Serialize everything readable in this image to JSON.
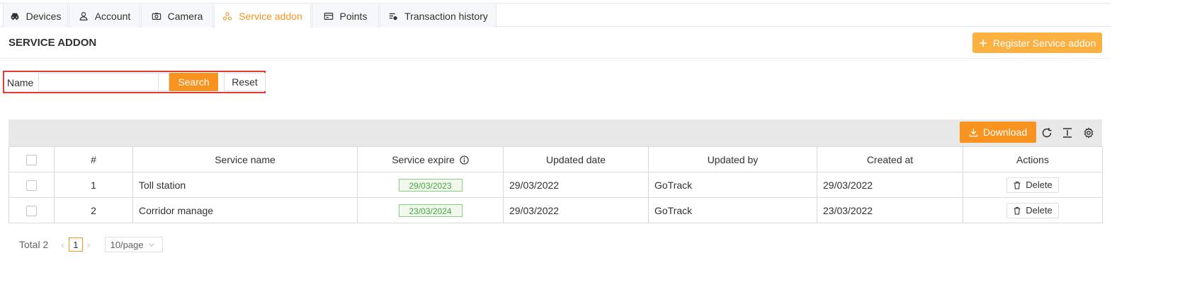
{
  "tabs": [
    {
      "label": "Devices",
      "icon": "car-icon"
    },
    {
      "label": "Account",
      "icon": "user-icon"
    },
    {
      "label": "Camera",
      "icon": "camera-icon"
    },
    {
      "label": "Service addon",
      "icon": "addon-icon",
      "active": true
    },
    {
      "label": "Points",
      "icon": "card-icon"
    },
    {
      "label": "Transaction history",
      "icon": "history-icon"
    }
  ],
  "header": {
    "title": "SERVICE ADDON",
    "register_label": "Register Service addon"
  },
  "search": {
    "name_label": "Name",
    "name_value": "",
    "search_label": "Search",
    "reset_label": "Reset"
  },
  "toolbar": {
    "download_label": "Download"
  },
  "table": {
    "columns": {
      "index": "#",
      "service_name": "Service name",
      "service_expire": "Service expire",
      "updated_date": "Updated date",
      "updated_by": "Updated by",
      "created_at": "Created at",
      "actions": "Actions"
    },
    "rows": [
      {
        "index": "1",
        "service_name": "Toll station",
        "service_expire": "29/03/2023",
        "updated_date": "29/03/2022",
        "updated_by": "GoTrack",
        "created_at": "29/03/2022",
        "action": "Delete"
      },
      {
        "index": "2",
        "service_name": "Corridor manage",
        "service_expire": "23/03/2024",
        "updated_date": "29/03/2022",
        "updated_by": "GoTrack",
        "created_at": "23/03/2022",
        "action": "Delete"
      }
    ]
  },
  "pagination": {
    "total": "Total 2",
    "current_page": "1",
    "page_size": "10/page"
  },
  "colors": {
    "accent": "#f7931e",
    "register": "#fbb040",
    "badge_green": "#43a843",
    "highlight_border": "#e53935"
  }
}
